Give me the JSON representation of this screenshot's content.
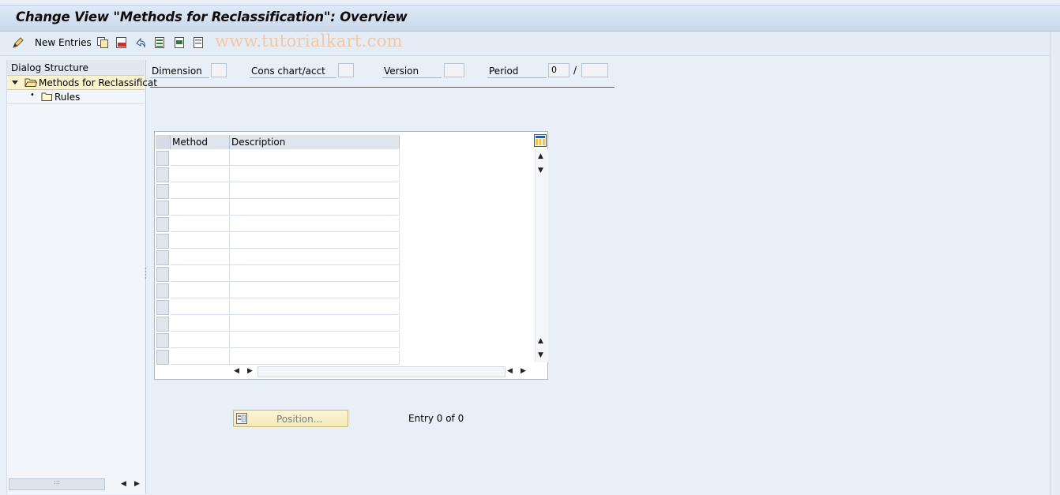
{
  "title": "Change View \"Methods for Reclassification\": Overview",
  "toolbar": {
    "new_entries_label": "New Entries",
    "watermark": "www.tutorialkart.com",
    "icons": [
      "pen-icon",
      "copy-icon",
      "delete-icon",
      "undo-icon",
      "select-all-icon",
      "select-block-icon",
      "deselect-all-icon"
    ]
  },
  "dialog_structure": {
    "header": "Dialog Structure",
    "items": [
      {
        "label": "Methods for Reclassificat",
        "icon": "open-folder-icon",
        "selected": true
      },
      {
        "label": "Rules",
        "icon": "folder-icon",
        "selected": false
      }
    ]
  },
  "fields": {
    "dimension": {
      "label": "Dimension",
      "value": ""
    },
    "cons_chart": {
      "label": "Cons chart/acct",
      "value": ""
    },
    "version": {
      "label": "Version",
      "value": ""
    },
    "period": {
      "label": "Period",
      "value": "0",
      "separator": "/",
      "year": ""
    }
  },
  "table": {
    "columns": [
      "Method",
      "Description"
    ],
    "rows": [],
    "visible_empty_rows": 13
  },
  "position_button": "Position...",
  "entry_count": "Entry 0 of 0",
  "colors": {
    "selected_row": "#fbf3cc",
    "background": "#e9eff6",
    "title_bar": "#c9d8ea"
  }
}
